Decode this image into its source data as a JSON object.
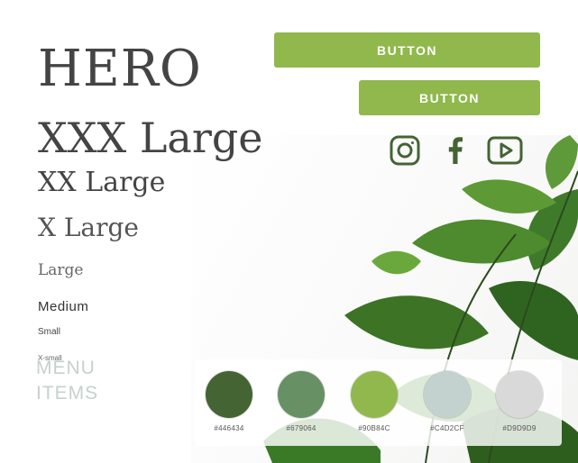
{
  "typography": {
    "hero": "HERO",
    "xxx_large": "XXX Large",
    "xx_large": "XX Large",
    "x_large": "X Large",
    "large": "Large",
    "medium": "Medium",
    "small": "Small",
    "x_small": "X-small"
  },
  "menu": {
    "line1": "MENU",
    "line2": "ITEMS"
  },
  "buttons": {
    "primary_label": "BUTTON",
    "secondary_label": "BUTTON"
  },
  "social_icons": [
    "instagram-icon",
    "facebook-icon",
    "youtube-icon"
  ],
  "palette": [
    {
      "hex": "#446434",
      "label": "#446434"
    },
    {
      "hex": "#679064",
      "label": "#679064"
    },
    {
      "hex": "#90B84C",
      "label": "#90B84C"
    },
    {
      "hex": "#C4D2CF",
      "label": "#C4D2CF"
    },
    {
      "hex": "#D9D9D9",
      "label": "#D9D9D9"
    }
  ],
  "colors": {
    "accent": "#90b84c",
    "icon": "#446434",
    "text": "#444444"
  }
}
